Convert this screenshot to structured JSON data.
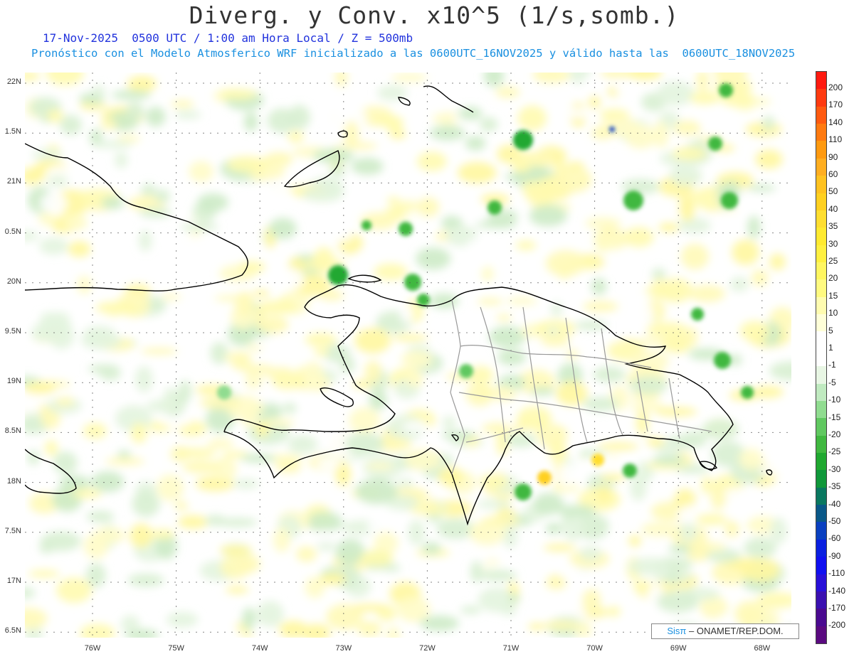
{
  "title": "Diverg. y Conv. x10^5 (1/s,somb.)",
  "subtitle": "17-Nov-2025  0500 UTC / 1:00 am Hora Local / Z = 500mb",
  "subtitle2": "Pronóstico con el Modelo Atmosferico WRF inicializado a las 0600UTC_16NOV2025 y válido hasta las  0600UTC_18NOV2025",
  "lat_labels": [
    "22N",
    "1.5N",
    "21N",
    "0.5N",
    "20N",
    "9.5N",
    "19N",
    "8.5N",
    "18N",
    "7.5N",
    "17N",
    "6.5N"
  ],
  "lon_labels": [
    "76W",
    "75W",
    "74W",
    "73W",
    "72W",
    "71W",
    "70W",
    "69W",
    "68W"
  ],
  "colorbar": {
    "labels": [
      "200",
      "170",
      "140",
      "110",
      "90",
      "60",
      "50",
      "40",
      "35",
      "30",
      "25",
      "20",
      "15",
      "10",
      "5",
      "1",
      "-1",
      "-5",
      "-10",
      "-15",
      "-20",
      "-25",
      "-30",
      "-35",
      "-40",
      "-50",
      "-60",
      "-90",
      "-110",
      "-140",
      "-170",
      "-200"
    ],
    "colors": [
      "#ff1a10",
      "#ff3a10",
      "#ff5a10",
      "#ff7a10",
      "#ff9a10",
      "#ffae20",
      "#ffc220",
      "#ffd020",
      "#ffde30",
      "#ffea30",
      "#fff040",
      "#fff660",
      "#fffa80",
      "#fffcb0",
      "#ffffd8",
      "#ffffff",
      "#ffffff",
      "#e8f6e4",
      "#c0eac0",
      "#90dc90",
      "#60c860",
      "#40b840",
      "#20a830",
      "#10983a",
      "#0a7860",
      "#0a5888",
      "#0a40c0",
      "#0a20e0",
      "#1010f0",
      "#2810d8",
      "#3a10b0",
      "#4a0a90",
      "#5a0a80"
    ]
  },
  "credit": {
    "sis": "Sisπ",
    "text": "– ONAMET/REP.DOM."
  }
}
